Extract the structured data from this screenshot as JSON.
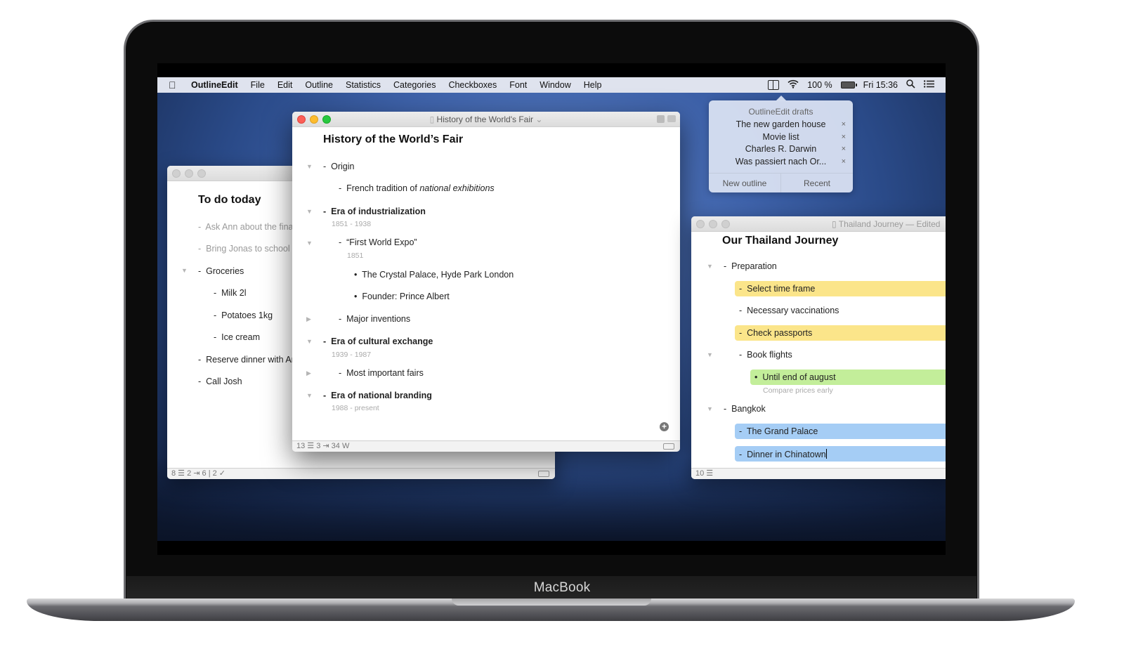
{
  "device": {
    "brand_label": "MacBook"
  },
  "menubar": {
    "app_name": "OutlineEdit",
    "items": [
      "File",
      "Edit",
      "Outline",
      "Statistics",
      "Categories",
      "Checkboxes",
      "Font",
      "Window",
      "Help"
    ],
    "battery": "100 %",
    "clock": "Fri 15:36"
  },
  "drafts_popover": {
    "title": "OutlineEdit drafts",
    "items": [
      "The new garden house",
      "Movie list",
      "Charles R. Darwin",
      "Was passiert nach Or..."
    ],
    "close_glyph": "×",
    "new_outline": "New outline",
    "recent": "Recent"
  },
  "todo_window": {
    "heading": "To do today",
    "rows": [
      {
        "text": "Ask Ann about the fina",
        "checked": true
      },
      {
        "text": "Bring Jonas to school",
        "checked": true
      },
      {
        "text": "Groceries",
        "checked": false
      },
      {
        "text": "Milk 2l",
        "checked": false
      },
      {
        "text": "Potatoes 1kg",
        "checked": false
      },
      {
        "text": "Ice cream",
        "checked": false
      },
      {
        "text": "Reserve dinner with An",
        "checked": false
      },
      {
        "text": "Call Josh",
        "checked": false
      }
    ],
    "status": "8 ☰  2 ⇥  6 | 2 ✓"
  },
  "history_window": {
    "window_title": "History of the World's Fair",
    "heading": "History of the World’s Fair",
    "rows": {
      "origin": "Origin",
      "french_prefix": "French tradition of ",
      "french_italic": "national exhibitions",
      "industrialization": "Era of industrialization",
      "industrialization_note": "1851 - 1938",
      "first_expo": "“First World Expo”",
      "first_expo_note": "1851",
      "crystal_palace": "The Crystal Palace, Hyde Park London",
      "founder": "Founder: Prince Albert",
      "inventions": "Major inventions",
      "cultural": "Era of cultural exchange",
      "cultural_note": "1939 - 1987",
      "fairs": "Most important fairs",
      "branding": "Era of national branding",
      "branding_note": "1988 - present"
    },
    "status": "13 ☰  3 ⇥  34 W"
  },
  "thailand_window": {
    "window_title": "Thailand Journey — Edited",
    "heading": "Our Thailand Journey",
    "rows": {
      "preparation": "Preparation",
      "time_frame": "Select time frame",
      "vaccinations": "Necessary vaccinations",
      "passports": "Check passports",
      "flights": "Book flights",
      "august": "Until end of august",
      "august_note": "Compare prices early",
      "bangkok": "Bangkok",
      "grand_palace": "The Grand Palace",
      "chinatown": "Dinner in Chinatown"
    },
    "highlight_colors": {
      "yellow": "#fbe58a",
      "green": "#c3ee9a",
      "blue": "#a5cdf5"
    },
    "status": "10 ☰"
  }
}
